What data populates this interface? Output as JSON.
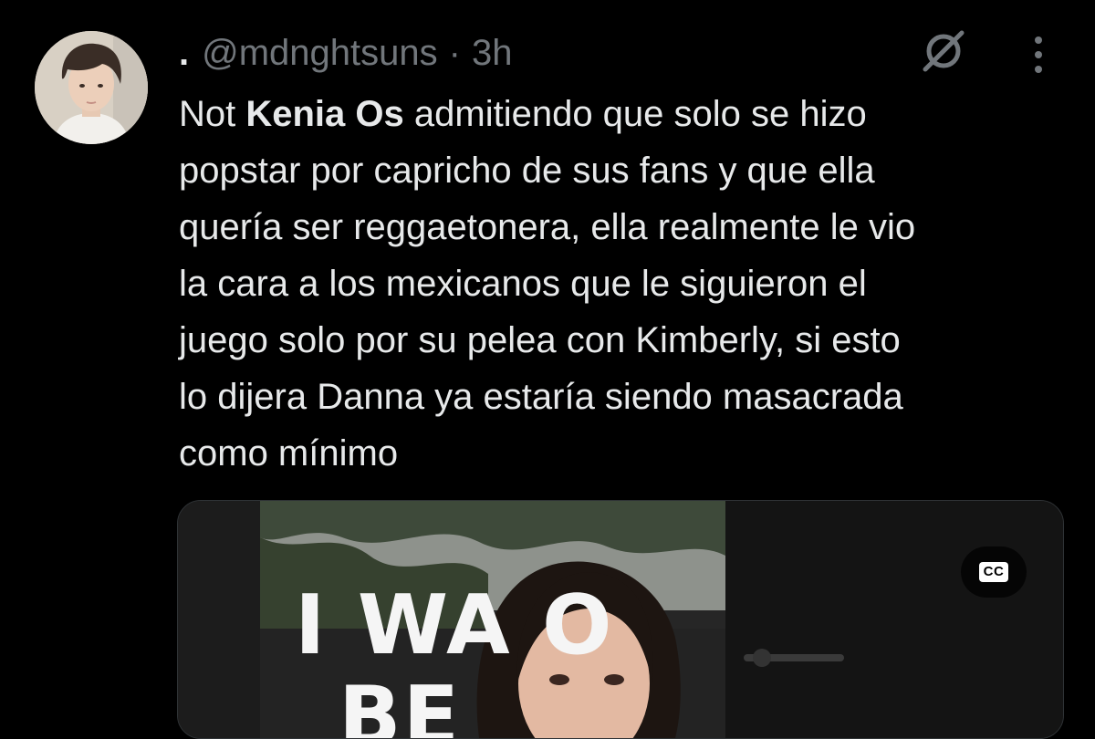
{
  "tweet": {
    "display_name": ".",
    "handle": "@mdnghtsuns",
    "separator": "·",
    "time": "3h",
    "text_lines": [
      {
        "before": "Not ",
        "bold": "Kenia Os",
        "after": " admitiendo que solo se hizo"
      },
      {
        "before": "popstar por capricho de sus fans y que ella",
        "bold": "",
        "after": ""
      },
      {
        "before": "quería ser reggaetonera, ella realmente le vio",
        "bold": "",
        "after": ""
      },
      {
        "before": "la cara a los mexicanos que le siguieron el",
        "bold": "",
        "after": ""
      },
      {
        "before": "juego solo por su pelea con Kimberly, si esto",
        "bold": "",
        "after": ""
      },
      {
        "before": "lo dijera Danna ya estaría siendo masacrada",
        "bold": "",
        "after": ""
      },
      {
        "before": "como mínimo",
        "bold": "",
        "after": ""
      }
    ],
    "icons": {
      "grok": "grok-icon",
      "more": "more-vertical-icon"
    }
  },
  "media": {
    "cc_label": "CC",
    "overlay_text_1": "I WA  O",
    "overlay_text_2": "BE"
  },
  "colors": {
    "background": "#000000",
    "text_primary": "#e7e9ea",
    "text_secondary": "#71767b"
  }
}
